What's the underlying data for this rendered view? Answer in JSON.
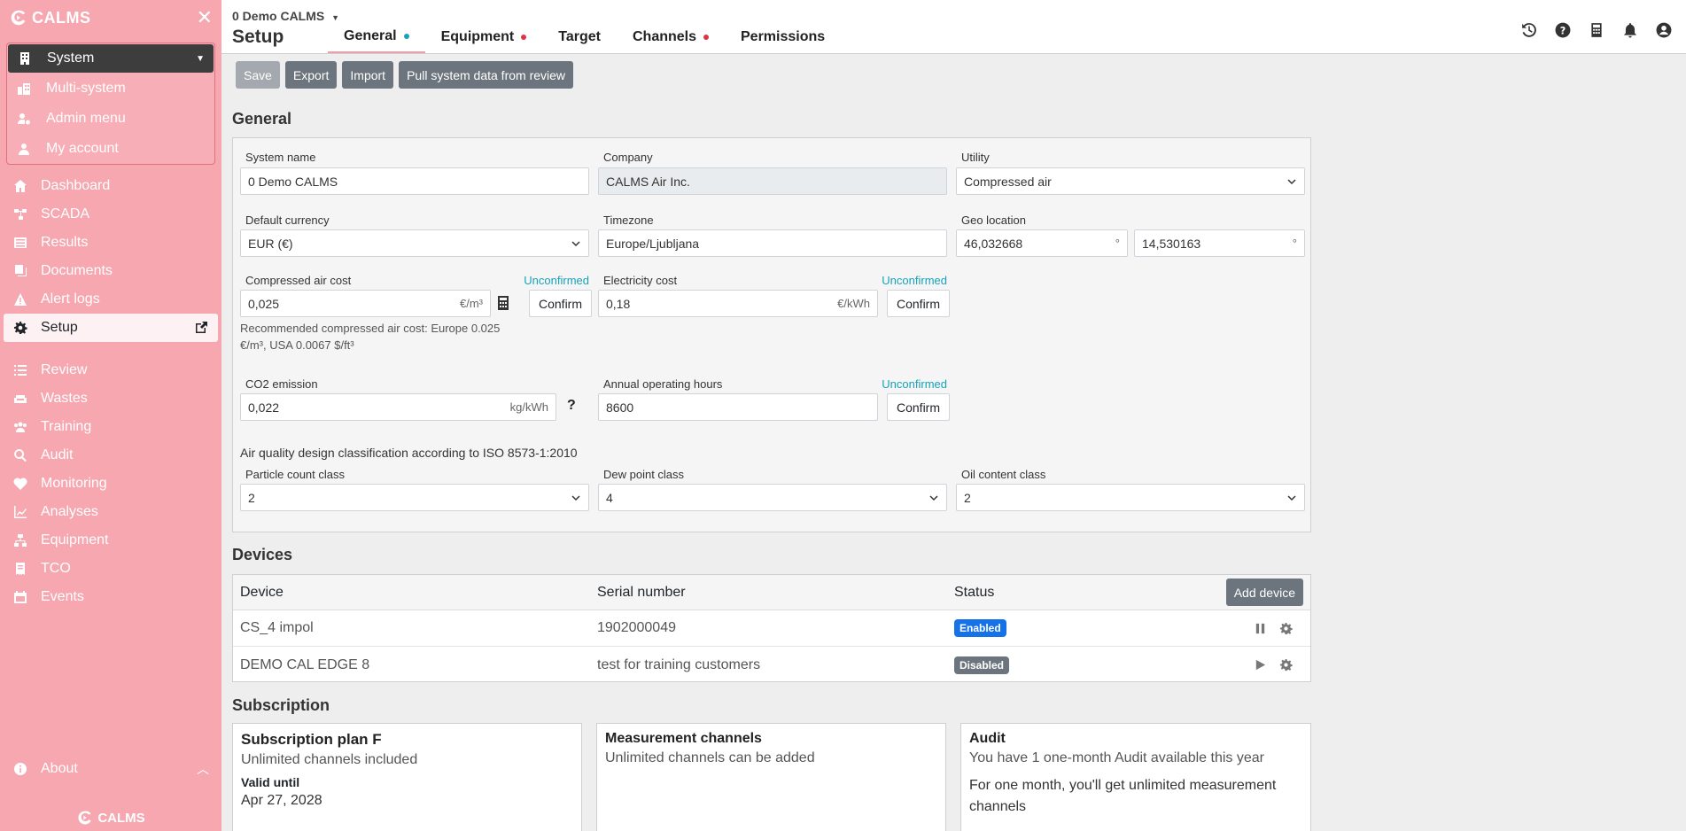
{
  "brand": "CALMS",
  "sidebar": {
    "system_menu": {
      "label": "System",
      "items": [
        {
          "label": "Multi-system",
          "icon": "buildings-icon"
        },
        {
          "label": "Admin menu",
          "icon": "user-cog-icon"
        },
        {
          "label": "My account",
          "icon": "user-icon"
        }
      ]
    },
    "nav": [
      {
        "label": "Dashboard",
        "icon": "home-icon"
      },
      {
        "label": "SCADA",
        "icon": "network-icon"
      },
      {
        "label": "Results",
        "icon": "list-icon"
      },
      {
        "label": "Documents",
        "icon": "documents-icon"
      },
      {
        "label": "Alert logs",
        "icon": "warning-icon"
      },
      {
        "label": "Setup",
        "icon": "gear-icon",
        "active": true
      }
    ],
    "nav2": [
      {
        "label": "Review",
        "icon": "list-icon"
      },
      {
        "label": "Wastes",
        "icon": "couch-icon"
      },
      {
        "label": "Training",
        "icon": "users-icon"
      },
      {
        "label": "Audit",
        "icon": "search-icon"
      },
      {
        "label": "Monitoring",
        "icon": "heartbeat-icon"
      },
      {
        "label": "Analyses",
        "icon": "chart-line-icon"
      },
      {
        "label": "Equipment",
        "icon": "sitemap-icon"
      },
      {
        "label": "TCO",
        "icon": "receipt-icon"
      },
      {
        "label": "Events",
        "icon": "calendar-icon"
      }
    ],
    "about": "About",
    "footer": "CALMS"
  },
  "header": {
    "system_name": "0 Demo CALMS",
    "page_title": "Setup",
    "tabs": [
      {
        "label": "General",
        "dot": "#17a2b8",
        "active": true
      },
      {
        "label": "Equipment",
        "dot": "#dc3545"
      },
      {
        "label": "Target"
      },
      {
        "label": "Channels",
        "dot": "#dc3545"
      },
      {
        "label": "Permissions"
      }
    ]
  },
  "toolbar": {
    "save": "Save",
    "export": "Export",
    "import": "Import",
    "pull": "Pull system data from review"
  },
  "general": {
    "title": "General",
    "system_name": {
      "label": "System name",
      "value": "0 Demo CALMS"
    },
    "company": {
      "label": "Company",
      "value": "CALMS Air Inc."
    },
    "utility": {
      "label": "Utility",
      "value": "Compressed air"
    },
    "currency": {
      "label": "Default currency",
      "value": "EUR (€)"
    },
    "timezone": {
      "label": "Timezone",
      "value": "Europe/Ljubljana"
    },
    "geo": {
      "label": "Geo location",
      "lat": "46,032668",
      "lon": "14,530163",
      "unit": "°"
    },
    "air_cost": {
      "label": "Compressed air cost",
      "value": "0,025",
      "unit": "€/m³",
      "status": "Unconfirmed",
      "button": "Confirm"
    },
    "electricity_cost": {
      "label": "Electricity cost",
      "value": "0,18",
      "unit": "€/kWh",
      "status": "Unconfirmed",
      "button": "Confirm"
    },
    "hint_line1": "Recommended compressed air cost: Europe 0.025",
    "hint_line2": "€/m³, USA 0.0067 $/ft³",
    "co2": {
      "label": "CO2 emission",
      "value": "0,022",
      "unit": "kg/kWh",
      "help": "?"
    },
    "hours": {
      "label": "Annual operating hours",
      "value": "8600",
      "status": "Unconfirmed",
      "button": "Confirm"
    },
    "air_quality_heading": "Air quality design classification according to ISO 8573-1:2010",
    "particle": {
      "label": "Particle count class",
      "value": "2"
    },
    "dew": {
      "label": "Dew point class",
      "value": "4"
    },
    "oil": {
      "label": "Oil content class",
      "value": "2"
    }
  },
  "devices": {
    "title": "Devices",
    "columns": [
      "Device",
      "Serial number",
      "Status"
    ],
    "add_button": "Add device",
    "rows": [
      {
        "device": "CS_4 impol",
        "serial": "1902000049",
        "status": "Enabled",
        "color": "#1572e8"
      },
      {
        "device": "DEMO CAL EDGE 8",
        "serial": "test for training customers",
        "status": "Disabled",
        "color": "#6c757d"
      }
    ]
  },
  "subscription": {
    "title": "Subscription",
    "plan": {
      "title": "Subscription plan F",
      "text": "Unlimited channels included",
      "valid_label": "Valid until",
      "valid_value": "Apr 27, 2028"
    },
    "channels": {
      "title": "Measurement channels",
      "text": "Unlimited channels can be added"
    },
    "audit": {
      "title": "Audit",
      "text": "You have 1 one-month Audit available this year",
      "text2": "For one month, you'll get unlimited measurement channels"
    }
  }
}
